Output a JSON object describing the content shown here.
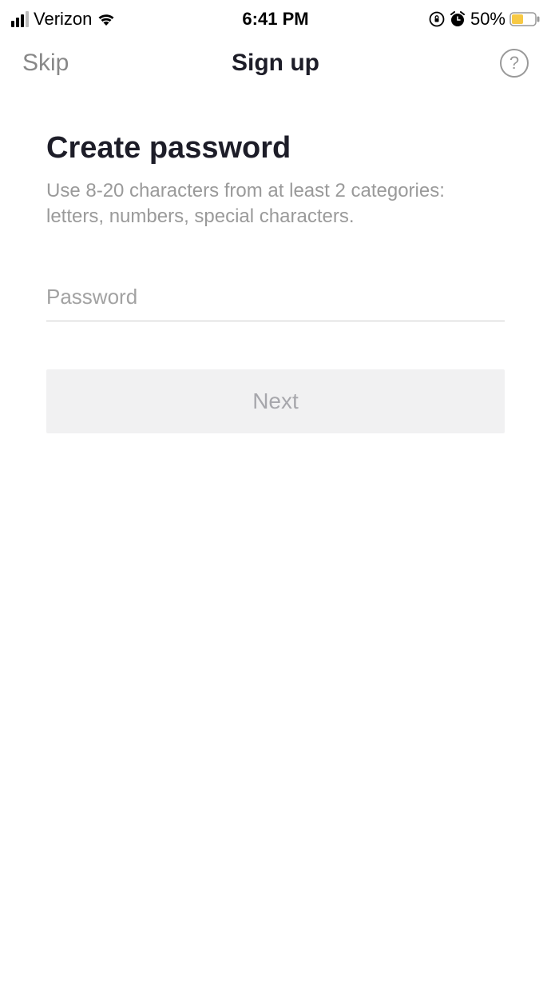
{
  "status": {
    "carrier": "Verizon",
    "time": "6:41 PM",
    "battery_pct": "50%"
  },
  "nav": {
    "skip_label": "Skip",
    "title": "Sign up",
    "help_label": "?"
  },
  "main": {
    "heading": "Create password",
    "subheading": "Use 8-20 characters from at least 2 categories: letters, numbers, special characters.",
    "password_placeholder": "Password",
    "password_value": "",
    "next_label": "Next"
  }
}
